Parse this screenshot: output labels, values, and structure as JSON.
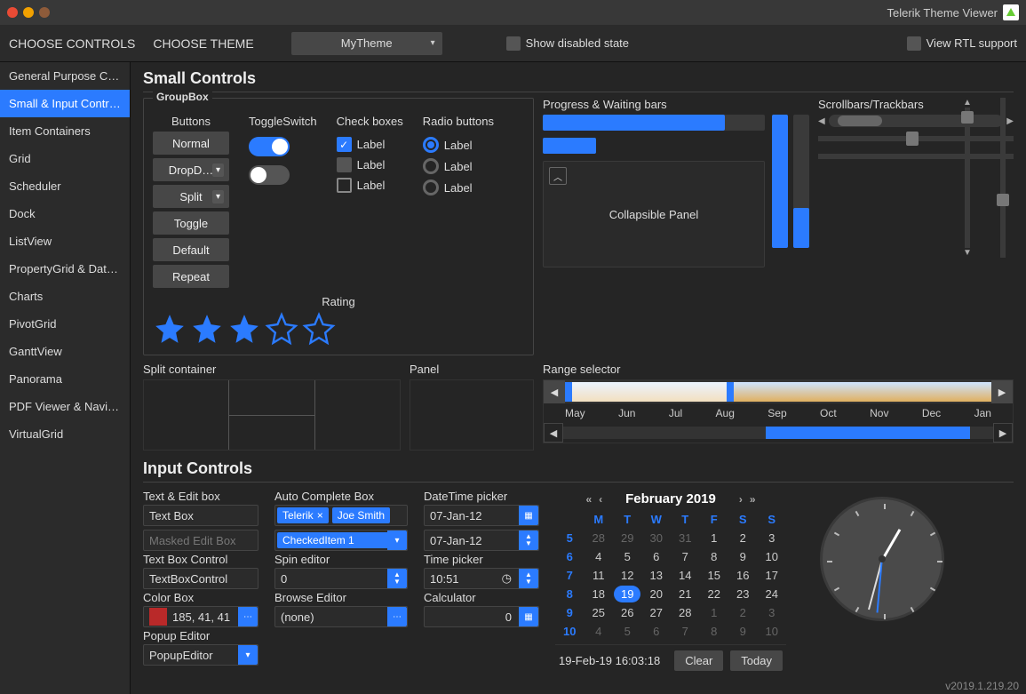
{
  "app_title": "Telerik Theme Viewer",
  "toolbar": {
    "choose_controls": "CHOOSE CONTROLS",
    "choose_theme": "CHOOSE THEME",
    "theme_value": "MyTheme",
    "show_disabled": "Show disabled state",
    "view_rtl": "View RTL support"
  },
  "sidebar": {
    "items": [
      "General Purpose C…",
      "Small & Input Contr…",
      "Item Containers",
      "Grid",
      "Scheduler",
      "Dock",
      "ListView",
      "PropertyGrid & Dat…",
      "Charts",
      "PivotGrid",
      "GanttView",
      "Panorama",
      "PDF Viewer & Navig…",
      "VirtualGrid"
    ],
    "active_index": 1
  },
  "section1_title": "Small Controls",
  "groupbox": {
    "legend": "GroupBox",
    "buttons_label": "Buttons",
    "buttons": [
      "Normal",
      "DropD…",
      "Split",
      "Toggle",
      "Default",
      "Repeat"
    ],
    "toggle_label": "ToggleSwitch",
    "checkboxes_label": "Check boxes",
    "cb_text": "Label",
    "radio_label": "Radio buttons",
    "rating_label": "Rating",
    "rating_value": 3,
    "rating_max": 5
  },
  "progress": {
    "label": "Progress & Waiting bars",
    "h1_pct": 82,
    "h2_pct": 15,
    "v1_pct": 100,
    "v2_pct": 30,
    "collapsible": "Collapsible Panel"
  },
  "scroll_label": "Scrollbars/Trackbars",
  "row2": {
    "split_label": "Split container",
    "panel_label": "Panel",
    "range_label": "Range selector",
    "months": [
      "May",
      "Jun",
      "Jul",
      "Aug",
      "Sep",
      "Oct",
      "Nov",
      "Dec",
      "Jan"
    ]
  },
  "section2_title": "Input Controls",
  "inputs": {
    "text_edit_label": "Text & Edit box",
    "textbox_value": "Text Box",
    "masked_placeholder": "Masked Edit Box",
    "tbc_label": "Text Box Control",
    "tbc_value": "TextBoxControl",
    "color_label": "Color Box",
    "color_value": "185, 41, 41",
    "popup_label": "Popup Editor",
    "popup_value": "PopupEditor",
    "auto_label": "Auto Complete Box",
    "tag1": "Telerik",
    "tag2": "Joe Smith",
    "checked_item": "CheckedItem 1",
    "spin_label": "Spin editor",
    "spin_value": "0",
    "browse_label": "Browse Editor",
    "browse_value": "(none)",
    "dt_label": "DateTime picker",
    "dt_value": "07-Jan-12",
    "time_label": "Time picker",
    "time_value": "10:51",
    "calc_label": "Calculator",
    "calc_value": "0"
  },
  "calendar": {
    "title": "February 2019",
    "dow": [
      "M",
      "T",
      "W",
      "T",
      "F",
      "S",
      "S"
    ],
    "weeks": [
      {
        "wk": "5",
        "d": [
          "28",
          "29",
          "30",
          "31",
          "1",
          "2",
          "3"
        ],
        "dim": [
          0,
          1,
          2,
          3
        ]
      },
      {
        "wk": "6",
        "d": [
          "4",
          "5",
          "6",
          "7",
          "8",
          "9",
          "10"
        ],
        "dim": []
      },
      {
        "wk": "7",
        "d": [
          "11",
          "12",
          "13",
          "14",
          "15",
          "16",
          "17"
        ],
        "dim": []
      },
      {
        "wk": "8",
        "d": [
          "18",
          "19",
          "20",
          "21",
          "22",
          "23",
          "24"
        ],
        "dim": [],
        "today": 1
      },
      {
        "wk": "9",
        "d": [
          "25",
          "26",
          "27",
          "28",
          "1",
          "2",
          "3"
        ],
        "dim": [
          4,
          5,
          6
        ]
      },
      {
        "wk": "10",
        "d": [
          "4",
          "5",
          "6",
          "7",
          "8",
          "9",
          "10"
        ],
        "dim": [
          0,
          1,
          2,
          3,
          4,
          5,
          6
        ]
      }
    ],
    "footer_date": "19-Feb-19 16:03:18",
    "clear": "Clear",
    "today": "Today"
  },
  "version": "v2019.1.219.20"
}
